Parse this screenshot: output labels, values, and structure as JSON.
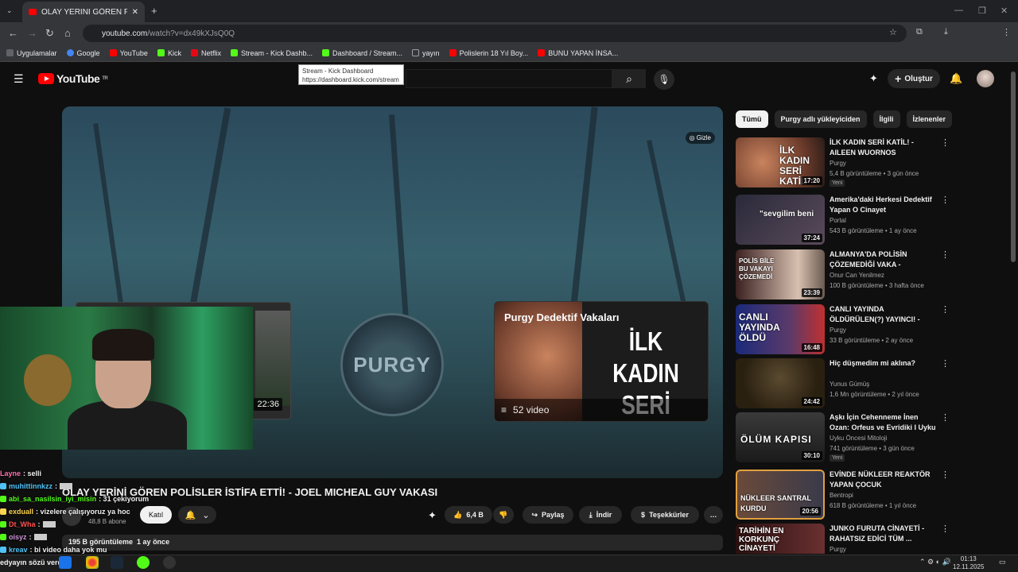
{
  "browser": {
    "tab_title": "OLAY YERİNİ GÖREN POLİSLER",
    "url_domain": "youtube.com",
    "url_path": "/watch?v=dx49kXJsQ0Q",
    "bookmarks": [
      {
        "label": "Uygulamalar",
        "color": "#5f6368"
      },
      {
        "label": "Google",
        "color": "#4285f4"
      },
      {
        "label": "YouTube",
        "color": "#ff0000"
      },
      {
        "label": "Kick",
        "color": "#53fc18"
      },
      {
        "label": "Netflix",
        "color": "#e50914"
      },
      {
        "label": "Stream - Kick Dashb...",
        "color": "#53fc18"
      },
      {
        "label": "Dashboard / Stream...",
        "color": "#53fc18"
      },
      {
        "label": "yayın",
        "color": "#9aa0a6"
      },
      {
        "label": "Polislerin 18 Yıl Boy...",
        "color": "#ff0000"
      },
      {
        "label": "BUNU YAPAN İNSA...",
        "color": "#ff0000"
      }
    ],
    "tooltip_title": "Stream - Kick Dashboard",
    "tooltip_url": "https://dashboard.kick.com/stream"
  },
  "youtube": {
    "logo_text": "YouTube",
    "logo_sup": "TR",
    "create_label": "Oluştur"
  },
  "player": {
    "hide_label": "Gizle",
    "center_logo": "PURGY",
    "left_card_duration": "22:36",
    "playlist_title": "Purgy Dedektif Vakaları",
    "playlist_big_line1": "İLK KADIN",
    "playlist_big_line2": "SERİ KATİL",
    "playlist_count": "52 video"
  },
  "video": {
    "title": "OLAY YERİNİ GÖREN POLİSLER İSTİFA ETTİ! - JOEL MICHEAL GUY VAKASI",
    "subscribers": "48,8 B abone",
    "join_label": "Katıl",
    "likes": "6,4 B",
    "share_label": "Paylaş",
    "download_label": "İndir",
    "thanks_label": "Teşekkürler",
    "views": "195 B görüntüleme",
    "date": "1 ay önce"
  },
  "chips": [
    "Tümü",
    "Purgy adlı yükleyiciden",
    "İlgili",
    "İzlenenler"
  ],
  "recommendations": [
    {
      "title": "İLK KADIN SERİ KATİL! - AILEEN WUORNOS BELGESELİ",
      "channel": "Purgy",
      "meta": "5,4 B görüntüleme • 3 gün önce",
      "badge": "Yeni",
      "duration": "17:20",
      "thumb_text": "İLK KADIN SERİ KATİL",
      "color": "#6a3a2a"
    },
    {
      "title": "Amerika'daki Herkesi Dedektif Yapan O Cinayet",
      "channel": "Portal",
      "meta": "543 B görüntüleme • 1 ay önce",
      "badge": "",
      "duration": "37:24",
      "thumb_text": "\"sevgilim beni",
      "color": "#3a3a4a"
    },
    {
      "title": "ALMANYA'DA POLİSİN ÇÖZEMEDİĞİ VAKA - REBECC...",
      "channel": "Onur Can Yenilmez",
      "meta": "100 B görüntüleme • 3 hafta önce",
      "badge": "",
      "duration": "23:39",
      "thumb_text": "POLİS BİLE BU VAKAYI ÇÖZEMEDİ",
      "color": "#4a3030"
    },
    {
      "title": "CANLI YAYINDA ÖLDÜRÜLEN(?) YAYINCI! - JEAN PORMANOVE...",
      "channel": "Purgy",
      "meta": "33 B görüntüleme • 2 ay önce",
      "badge": "",
      "duration": "16:48",
      "thumb_text": "CANLI YAYINDA ÖLDÜ",
      "color": "#2a3a7a"
    },
    {
      "title": "Hiç düşmedim mi aklına?",
      "channel": "Yunus Gümüş",
      "meta": "1,6 Mn görüntüleme • 2 yıl önce",
      "badge": "",
      "duration": "24:42",
      "thumb_text": "",
      "color": "#3a3020"
    },
    {
      "title": "Aşkı İçin Cehenneme İnen Ozan: Orfeus ve Evridiki I Uyku Önce...",
      "channel": "Uyku Öncesi Mitoloji",
      "meta": "741 görüntüleme • 3 gün önce",
      "badge": "Yeni",
      "duration": "30:10",
      "thumb_text": "ÖLÜM KAPISI",
      "color": "#2a2a2a"
    },
    {
      "title": "EVİNDE NÜKLEER REAKTÖR YAPAN ÇOCUK",
      "channel": "Bentropi",
      "meta": "618 B görüntüleme • 1 yıl önce",
      "badge": "",
      "duration": "20:56",
      "thumb_text": "NÜKLEER SANTRAL KURDU",
      "color": "#5a3a20"
    },
    {
      "title": "JUNKO FURUTA CİNAYETİ - RAHATSIZ EDİCİ TÜM ...",
      "channel": "Purgy",
      "meta": "",
      "badge": "",
      "duration": "",
      "thumb_text": "TARİHİN EN KORKUNÇ CİNAYETİ",
      "color": "#3a1a1a"
    }
  ],
  "chat": [
    {
      "user": "Layne",
      "msg": ": selli",
      "color": "#ff6fae"
    },
    {
      "user": "muhittinnkzz",
      "msg": ":",
      "color": "#4fc3f7"
    },
    {
      "user": "abi_sa_nasilsin_iyi_misin",
      "msg": ": 31 çekiyorum",
      "color": "#53fc18"
    },
    {
      "user": "exduall",
      "msg": ": vizelere çalışıyoruz ya hoc",
      "color": "#ffd54f"
    },
    {
      "user": "Dt_Wha",
      "msg": ":",
      "color": "#ff5252"
    },
    {
      "user": "oisyz",
      "msg": ":",
      "color": "#ce93d8"
    },
    {
      "user": "kreav",
      "msg": ": bi video daha yok mu",
      "color": "#4fc3f7"
    },
    {
      "user": "edyayın sözü verdin",
      "msg": "",
      "color": "#ffffff"
    }
  ],
  "clock": {
    "time": "01:13",
    "date": "12.11.2025"
  }
}
